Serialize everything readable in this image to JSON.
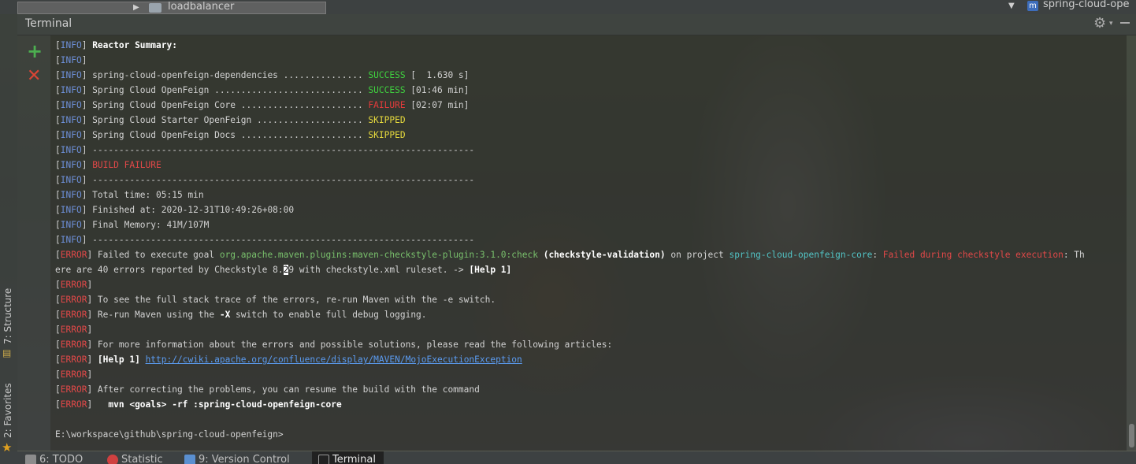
{
  "top": {
    "tab_left_label": "loadbalancer",
    "tab_right_label": "spring-cloud-ope",
    "tab_right_badge": "m"
  },
  "panel": {
    "title": "Terminal"
  },
  "side_tabs": {
    "structure": "7: Structure",
    "favorites": "2: Favorites"
  },
  "bottom_tabs": {
    "todo": "6: TODO",
    "statistic": "Statistic",
    "vcs": "9: Version Control",
    "terminal": "Terminal"
  },
  "terminal": {
    "lines": [
      [
        {
          "t": "[",
          "c": "br"
        },
        {
          "t": "INFO",
          "c": "tag-info"
        },
        {
          "t": "] ",
          "c": "br"
        },
        {
          "t": "Reactor Summary:",
          "c": "b"
        }
      ],
      [
        {
          "t": "[",
          "c": "br"
        },
        {
          "t": "INFO",
          "c": "tag-info"
        },
        {
          "t": "]",
          "c": "br"
        }
      ],
      [
        {
          "t": "[",
          "c": "br"
        },
        {
          "t": "INFO",
          "c": "tag-info"
        },
        {
          "t": "] spring-cloud-openfeign-dependencies ............... ",
          "c": ""
        },
        {
          "t": "SUCCESS",
          "c": "ok"
        },
        {
          "t": " [  1.630 s]",
          "c": ""
        }
      ],
      [
        {
          "t": "[",
          "c": "br"
        },
        {
          "t": "INFO",
          "c": "tag-info"
        },
        {
          "t": "] Spring Cloud OpenFeign ............................ ",
          "c": ""
        },
        {
          "t": "SUCCESS",
          "c": "ok"
        },
        {
          "t": " [01:46 min]",
          "c": ""
        }
      ],
      [
        {
          "t": "[",
          "c": "br"
        },
        {
          "t": "INFO",
          "c": "tag-info"
        },
        {
          "t": "] Spring Cloud OpenFeign Core ....................... ",
          "c": ""
        },
        {
          "t": "FAILURE",
          "c": "fail"
        },
        {
          "t": " [02:07 min]",
          "c": ""
        }
      ],
      [
        {
          "t": "[",
          "c": "br"
        },
        {
          "t": "INFO",
          "c": "tag-info"
        },
        {
          "t": "] Spring Cloud Starter OpenFeign .................... ",
          "c": ""
        },
        {
          "t": "SKIPPED",
          "c": "skip"
        }
      ],
      [
        {
          "t": "[",
          "c": "br"
        },
        {
          "t": "INFO",
          "c": "tag-info"
        },
        {
          "t": "] Spring Cloud OpenFeign Docs ....................... ",
          "c": ""
        },
        {
          "t": "SKIPPED",
          "c": "skip"
        }
      ],
      [
        {
          "t": "[",
          "c": "br"
        },
        {
          "t": "INFO",
          "c": "tag-info"
        },
        {
          "t": "] ------------------------------------------------------------------------",
          "c": ""
        }
      ],
      [
        {
          "t": "[",
          "c": "br"
        },
        {
          "t": "INFO",
          "c": "tag-info"
        },
        {
          "t": "] ",
          "c": ""
        },
        {
          "t": "BUILD FAILURE",
          "c": "red"
        }
      ],
      [
        {
          "t": "[",
          "c": "br"
        },
        {
          "t": "INFO",
          "c": "tag-info"
        },
        {
          "t": "] ------------------------------------------------------------------------",
          "c": ""
        }
      ],
      [
        {
          "t": "[",
          "c": "br"
        },
        {
          "t": "INFO",
          "c": "tag-info"
        },
        {
          "t": "] Total time: 05:15 min",
          "c": ""
        }
      ],
      [
        {
          "t": "[",
          "c": "br"
        },
        {
          "t": "INFO",
          "c": "tag-info"
        },
        {
          "t": "] Finished at: 2020-12-31T10:49:26+08:00",
          "c": ""
        }
      ],
      [
        {
          "t": "[",
          "c": "br"
        },
        {
          "t": "INFO",
          "c": "tag-info"
        },
        {
          "t": "] Final Memory: 41M/107M",
          "c": ""
        }
      ],
      [
        {
          "t": "[",
          "c": "br"
        },
        {
          "t": "INFO",
          "c": "tag-info"
        },
        {
          "t": "] ------------------------------------------------------------------------",
          "c": ""
        }
      ],
      [
        {
          "t": "[",
          "c": "br"
        },
        {
          "t": "ERROR",
          "c": "tag-err"
        },
        {
          "t": "] Failed to execute goal ",
          "c": ""
        },
        {
          "t": "org.apache.maven.plugins:maven-checkstyle-plugin:3.1.0:check",
          "c": "grn"
        },
        {
          "t": " (checkstyle-validation)",
          "c": "b"
        },
        {
          "t": " on project ",
          "c": ""
        },
        {
          "t": "spring-cloud-openfeign-core",
          "c": "cyan"
        },
        {
          "t": ": ",
          "c": ""
        },
        {
          "t": "Failed during checkstyle execution",
          "c": "red"
        },
        {
          "t": ": Th",
          "c": ""
        }
      ],
      [
        {
          "t": "ere are 40 errors reported by Checkstyle 8.",
          "c": ""
        },
        {
          "t": "2",
          "c": "caret"
        },
        {
          "t": "9 with checkstyle.xml ruleset. -> ",
          "c": ""
        },
        {
          "t": "[Help 1]",
          "c": "b"
        }
      ],
      [
        {
          "t": "[",
          "c": "br"
        },
        {
          "t": "ERROR",
          "c": "tag-err"
        },
        {
          "t": "]",
          "c": "br"
        }
      ],
      [
        {
          "t": "[",
          "c": "br"
        },
        {
          "t": "ERROR",
          "c": "tag-err"
        },
        {
          "t": "] To see the full stack trace of the errors, re-run Maven with the -e switch.",
          "c": ""
        }
      ],
      [
        {
          "t": "[",
          "c": "br"
        },
        {
          "t": "ERROR",
          "c": "tag-err"
        },
        {
          "t": "] Re-run Maven using the ",
          "c": ""
        },
        {
          "t": "-X",
          "c": "b"
        },
        {
          "t": " switch to enable full debug logging.",
          "c": ""
        }
      ],
      [
        {
          "t": "[",
          "c": "br"
        },
        {
          "t": "ERROR",
          "c": "tag-err"
        },
        {
          "t": "]",
          "c": "br"
        }
      ],
      [
        {
          "t": "[",
          "c": "br"
        },
        {
          "t": "ERROR",
          "c": "tag-err"
        },
        {
          "t": "] For more information about the errors and possible solutions, please read the following articles:",
          "c": ""
        }
      ],
      [
        {
          "t": "[",
          "c": "br"
        },
        {
          "t": "ERROR",
          "c": "tag-err"
        },
        {
          "t": "] ",
          "c": ""
        },
        {
          "t": "[Help 1]",
          "c": "b"
        },
        {
          "t": " ",
          "c": ""
        },
        {
          "t": "http://cwiki.apache.org/confluence/display/MAVEN/MojoExecutionException",
          "c": "link"
        }
      ],
      [
        {
          "t": "[",
          "c": "br"
        },
        {
          "t": "ERROR",
          "c": "tag-err"
        },
        {
          "t": "]",
          "c": "br"
        }
      ],
      [
        {
          "t": "[",
          "c": "br"
        },
        {
          "t": "ERROR",
          "c": "tag-err"
        },
        {
          "t": "] After correcting the problems, you can resume the build with the command",
          "c": ""
        }
      ],
      [
        {
          "t": "[",
          "c": "br"
        },
        {
          "t": "ERROR",
          "c": "tag-err"
        },
        {
          "t": "]   ",
          "c": ""
        },
        {
          "t": "mvn <goals> -rf :spring-cloud-openfeign-core",
          "c": "b"
        }
      ],
      [
        {
          "t": "",
          "c": ""
        }
      ],
      [
        {
          "t": "E:\\workspace\\github\\spring-cloud-openfeign>",
          "c": ""
        }
      ]
    ]
  }
}
